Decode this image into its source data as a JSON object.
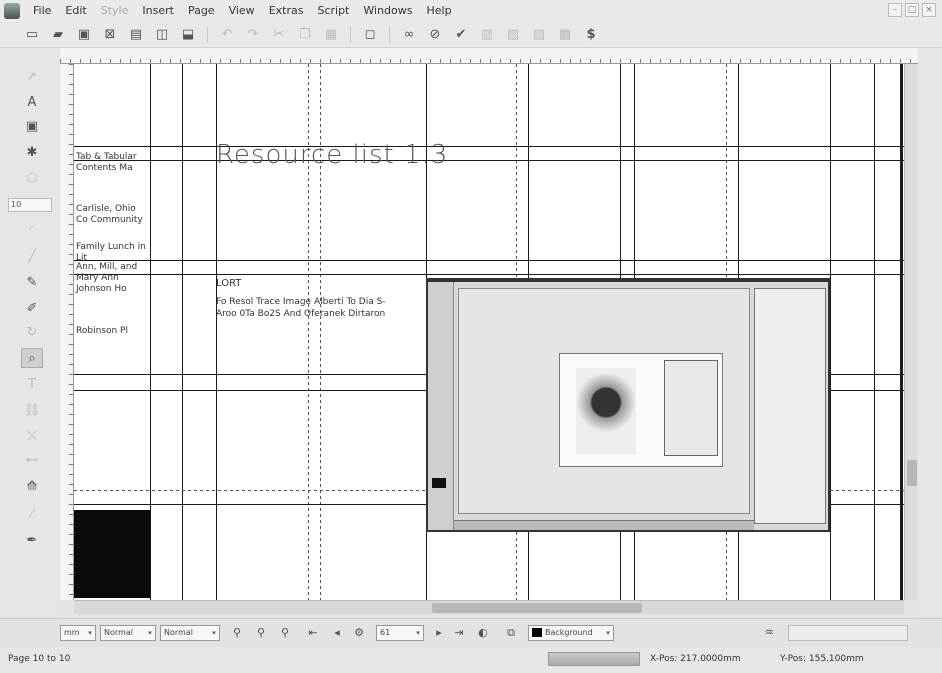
{
  "menubar": {
    "items": [
      {
        "label": "File",
        "disabled": false
      },
      {
        "label": "Edit",
        "disabled": false
      },
      {
        "label": "Style",
        "disabled": true
      },
      {
        "label": "Insert",
        "disabled": false
      },
      {
        "label": "Page",
        "disabled": false
      },
      {
        "label": "View",
        "disabled": false
      },
      {
        "label": "Extras",
        "disabled": false
      },
      {
        "label": "Script",
        "disabled": false
      },
      {
        "label": "Windows",
        "disabled": false
      },
      {
        "label": "Help",
        "disabled": false
      }
    ],
    "window_controls": [
      "–",
      "□",
      "×"
    ]
  },
  "toolbar": {
    "icons": [
      "new-document-icon",
      "open-icon",
      "save-icon",
      "close-icon",
      "print-icon",
      "preflight-icon",
      "export-pdf-icon",
      "undo-icon",
      "redo-icon",
      "cut-icon",
      "copy-icon",
      "paste-icon",
      "frame-icon",
      "link-icon",
      "unlink-icon",
      "check-icon",
      "pdf-button-icon",
      "pdf-field-icon",
      "pdf-link-icon",
      "pdf-annotation-icon",
      "script-icon"
    ]
  },
  "tools": {
    "icons": [
      "select-icon",
      "text-frame-icon",
      "image-frame-icon",
      "shape-icon",
      "polygon-icon",
      "arc-icon",
      "line-icon",
      "bezier-icon",
      "freehand-icon",
      "rotate-icon",
      "zoom-icon",
      "edit-text-icon",
      "link-frames-icon",
      "unlink-frames-icon",
      "measure-icon",
      "copy-properties-icon",
      "eyedropper-icon"
    ],
    "mini_field": "10"
  },
  "document": {
    "title": "Resource list 1.3",
    "side_notes": [
      "Tab & Tabular Contents Ma",
      "Carlisle, Ohio Co Community",
      "Family Lunch in Lit",
      "Ann, Mill, and Mary Ann Johnson Ho",
      "Robinson Pl"
    ],
    "body_head": "LORT",
    "body_text": "Fo Resol Trace Image Alberti To Dia S-Aroo 0Ta Bo2S And Oferanek Dirtaron"
  },
  "bottombar": {
    "unit": "mm",
    "preview_mode": "Normal",
    "view_mode": "Normal",
    "zoom": "61",
    "layer": "Background"
  },
  "statusbar": {
    "page_info": "Page 10 to 10",
    "x_pos": "X-Pos: 217.0000mm",
    "y_pos": "Y-Pos: 155.100mm"
  }
}
